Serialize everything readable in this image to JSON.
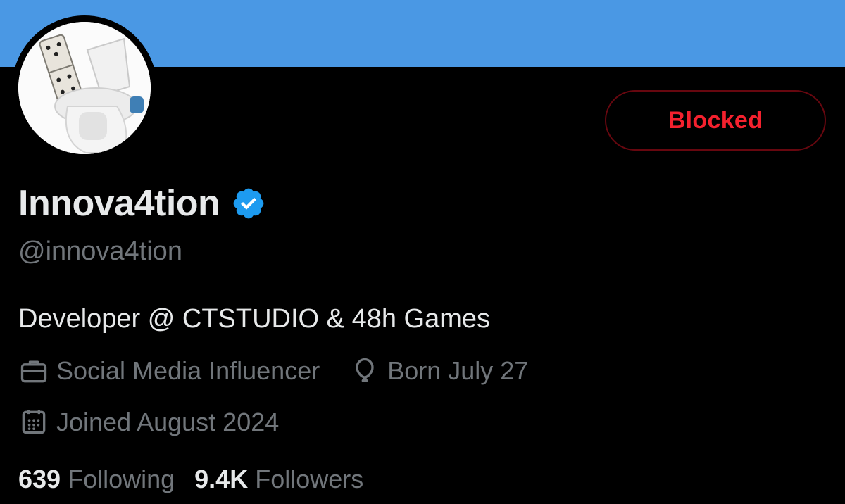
{
  "profile": {
    "display_name": "Innova4tion",
    "verified": true,
    "handle": "@innova4tion",
    "bio": "Developer @ CTSTUDIO & 48h Games",
    "category": "Social Media Influencer",
    "birthday": "Born July 27",
    "joined": "Joined August 2024"
  },
  "actions": {
    "blocked_label": "Blocked"
  },
  "stats": {
    "following_count": "639",
    "following_label": "Following",
    "followers_count": "9.4K",
    "followers_label": "Followers"
  },
  "colors": {
    "banner": "#4a98e4",
    "background": "#000000",
    "primary_text": "#e7e9ea",
    "secondary_text": "#71767b",
    "blocked_red": "#f4212e",
    "verified_blue": "#1d9bf0"
  },
  "icons": {
    "verified": "verified-badge-icon",
    "category": "briefcase-icon",
    "birthday": "balloon-icon",
    "joined": "calendar-icon"
  }
}
